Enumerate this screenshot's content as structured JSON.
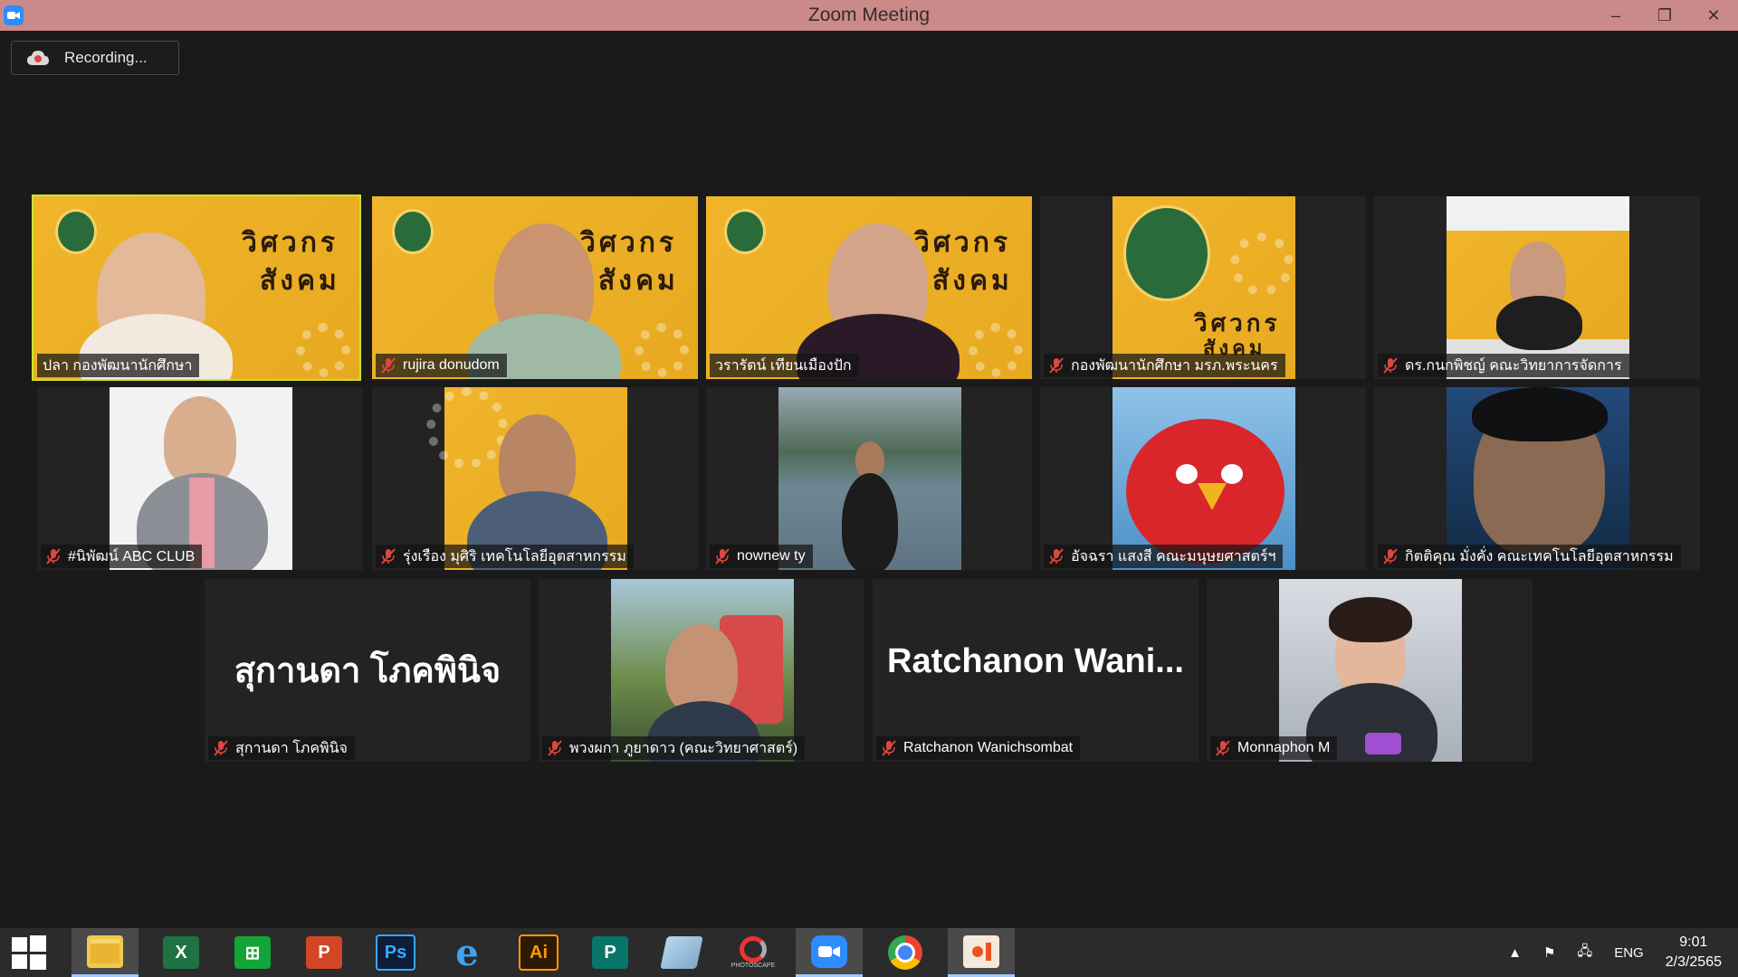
{
  "window": {
    "title": "Zoom Meeting",
    "controls": {
      "minimize": "–",
      "restore": "❐",
      "close": "✕"
    }
  },
  "recording": {
    "label": "Recording..."
  },
  "tiles": [
    {
      "name": "ปลา กองพัฒนานักศึกษา",
      "muted": false,
      "active": true,
      "kind": "video",
      "bg": "yellow"
    },
    {
      "name": "rujira donudom",
      "muted": true,
      "kind": "video",
      "bg": "yellow"
    },
    {
      "name": "วรารัตน์ เทียนเมืองปัก",
      "muted": true,
      "kind": "video",
      "bg": "yellow"
    },
    {
      "name": "กองพัฒนานักศึกษา มรภ.พระนคร",
      "muted": true,
      "kind": "image",
      "bg": "yellow"
    },
    {
      "name": "ดร.กนกพิชญ์ คณะวิทยาการจัดการ",
      "muted": true,
      "kind": "image",
      "bg": "photo-white"
    },
    {
      "name": "#นิพัฒน์ ABC CLUB",
      "muted": true,
      "kind": "image",
      "bg": "office"
    },
    {
      "name": "รุ่งเรือง มุศิริ เทคโนโลยีอุตสาหกรรม",
      "muted": true,
      "kind": "image",
      "bg": "yellow"
    },
    {
      "name": "nownew ty",
      "muted": true,
      "kind": "image",
      "bg": "lake"
    },
    {
      "name": "อัจฉรา แสงสี คณะมนุษยศาสตร์ฯ",
      "muted": true,
      "kind": "image",
      "bg": "bird"
    },
    {
      "name": "กิตติคุณ มั่งคั่ง คณะเทคโนโลยีอุตสาหกรรม",
      "muted": true,
      "kind": "image",
      "bg": "portrait"
    },
    {
      "name": "สุกานดา โภคพินิจ",
      "display": "สุกานดา โภคพินิจ",
      "muted": true,
      "kind": "name"
    },
    {
      "name": "พวงผกา ภูยาดาว (คณะวิทยาศาสตร์)",
      "muted": true,
      "kind": "image",
      "bg": "garden"
    },
    {
      "name": "Ratchanon Wanichsombat",
      "display": "Ratchanon  Wani...",
      "muted": true,
      "kind": "name"
    },
    {
      "name": "Monnaphon M",
      "muted": true,
      "kind": "image",
      "bg": "office"
    }
  ],
  "banner_text": {
    "line1": "วิศวกร",
    "line2": "สังคม"
  },
  "taskbar": {
    "apps": [
      {
        "icon": "windows-start-icon"
      },
      {
        "icon": "file-explorer-icon"
      },
      {
        "icon": "excel-icon",
        "label": "X"
      },
      {
        "icon": "store-icon",
        "label": "⊞"
      },
      {
        "icon": "powerpoint-icon",
        "label": "P"
      },
      {
        "icon": "photoshop-icon",
        "label": "Ps"
      },
      {
        "icon": "internet-explorer-icon",
        "label": "e"
      },
      {
        "icon": "illustrator-icon",
        "label": "Ai"
      },
      {
        "icon": "publisher-icon",
        "label": "P"
      },
      {
        "icon": "notes-icon"
      },
      {
        "icon": "photoscape-icon",
        "label": "PHOTOSCAPE"
      },
      {
        "icon": "zoom-icon"
      },
      {
        "icon": "chrome-icon"
      },
      {
        "icon": "paint-icon"
      }
    ],
    "tray": {
      "language": "ENG",
      "time": "9:01",
      "date": "2/3/2565"
    }
  },
  "colors": {
    "titlebar": "#cb8a8a",
    "active_speaker": "#c7e332",
    "muted_mic": "#e0463d",
    "taskbar": "#2b2b2b"
  }
}
